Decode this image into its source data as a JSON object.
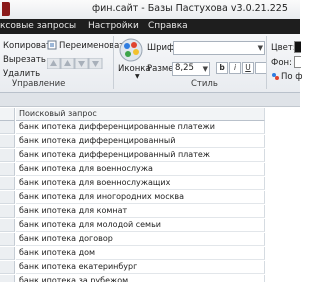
{
  "window": {
    "title": "фин.сайт - Базы Пастухова v3.0.21.225"
  },
  "menu": {
    "items": [
      "ксовые запросы",
      "Настройки",
      "Справка"
    ]
  },
  "ribbon": {
    "clipboard": {
      "copy": "Копировать",
      "cut": "Вырезать",
      "delete": "Удалить",
      "rename": "Переименовать",
      "label": "Управление"
    },
    "style": {
      "icon_label": "Иконка",
      "font_label": "Шрифт",
      "size_label": "Размер",
      "size_value": "8,25",
      "bold": "b",
      "italic": "i",
      "underline": "U",
      "label": "Стиль"
    },
    "color": {
      "color_label": "Цвет:",
      "bg_label": "Фон:",
      "default_label": "По ф"
    }
  },
  "grid": {
    "column_header": "Поисковый запрос",
    "rows": [
      "банк ипотека дифференцированные платежи",
      "банк ипотека дифференцированный",
      "банк ипотека дифференцированный платеж",
      "банк ипотека для военнослужа",
      "банк ипотека для военнослужащих",
      "банк ипотека для иногородних москва",
      "банк ипотека для комнат",
      "банк ипотека для молодой семьи",
      "банк ипотека договор",
      "банк ипотека дом",
      "банк ипотека екатеринбург",
      "банк ипотека за рубежом"
    ]
  },
  "colors": {
    "menubar_bg": "#1e1e1e",
    "ribbon_bg": "#eef0f3",
    "grid_line": "#d5dbe1"
  }
}
